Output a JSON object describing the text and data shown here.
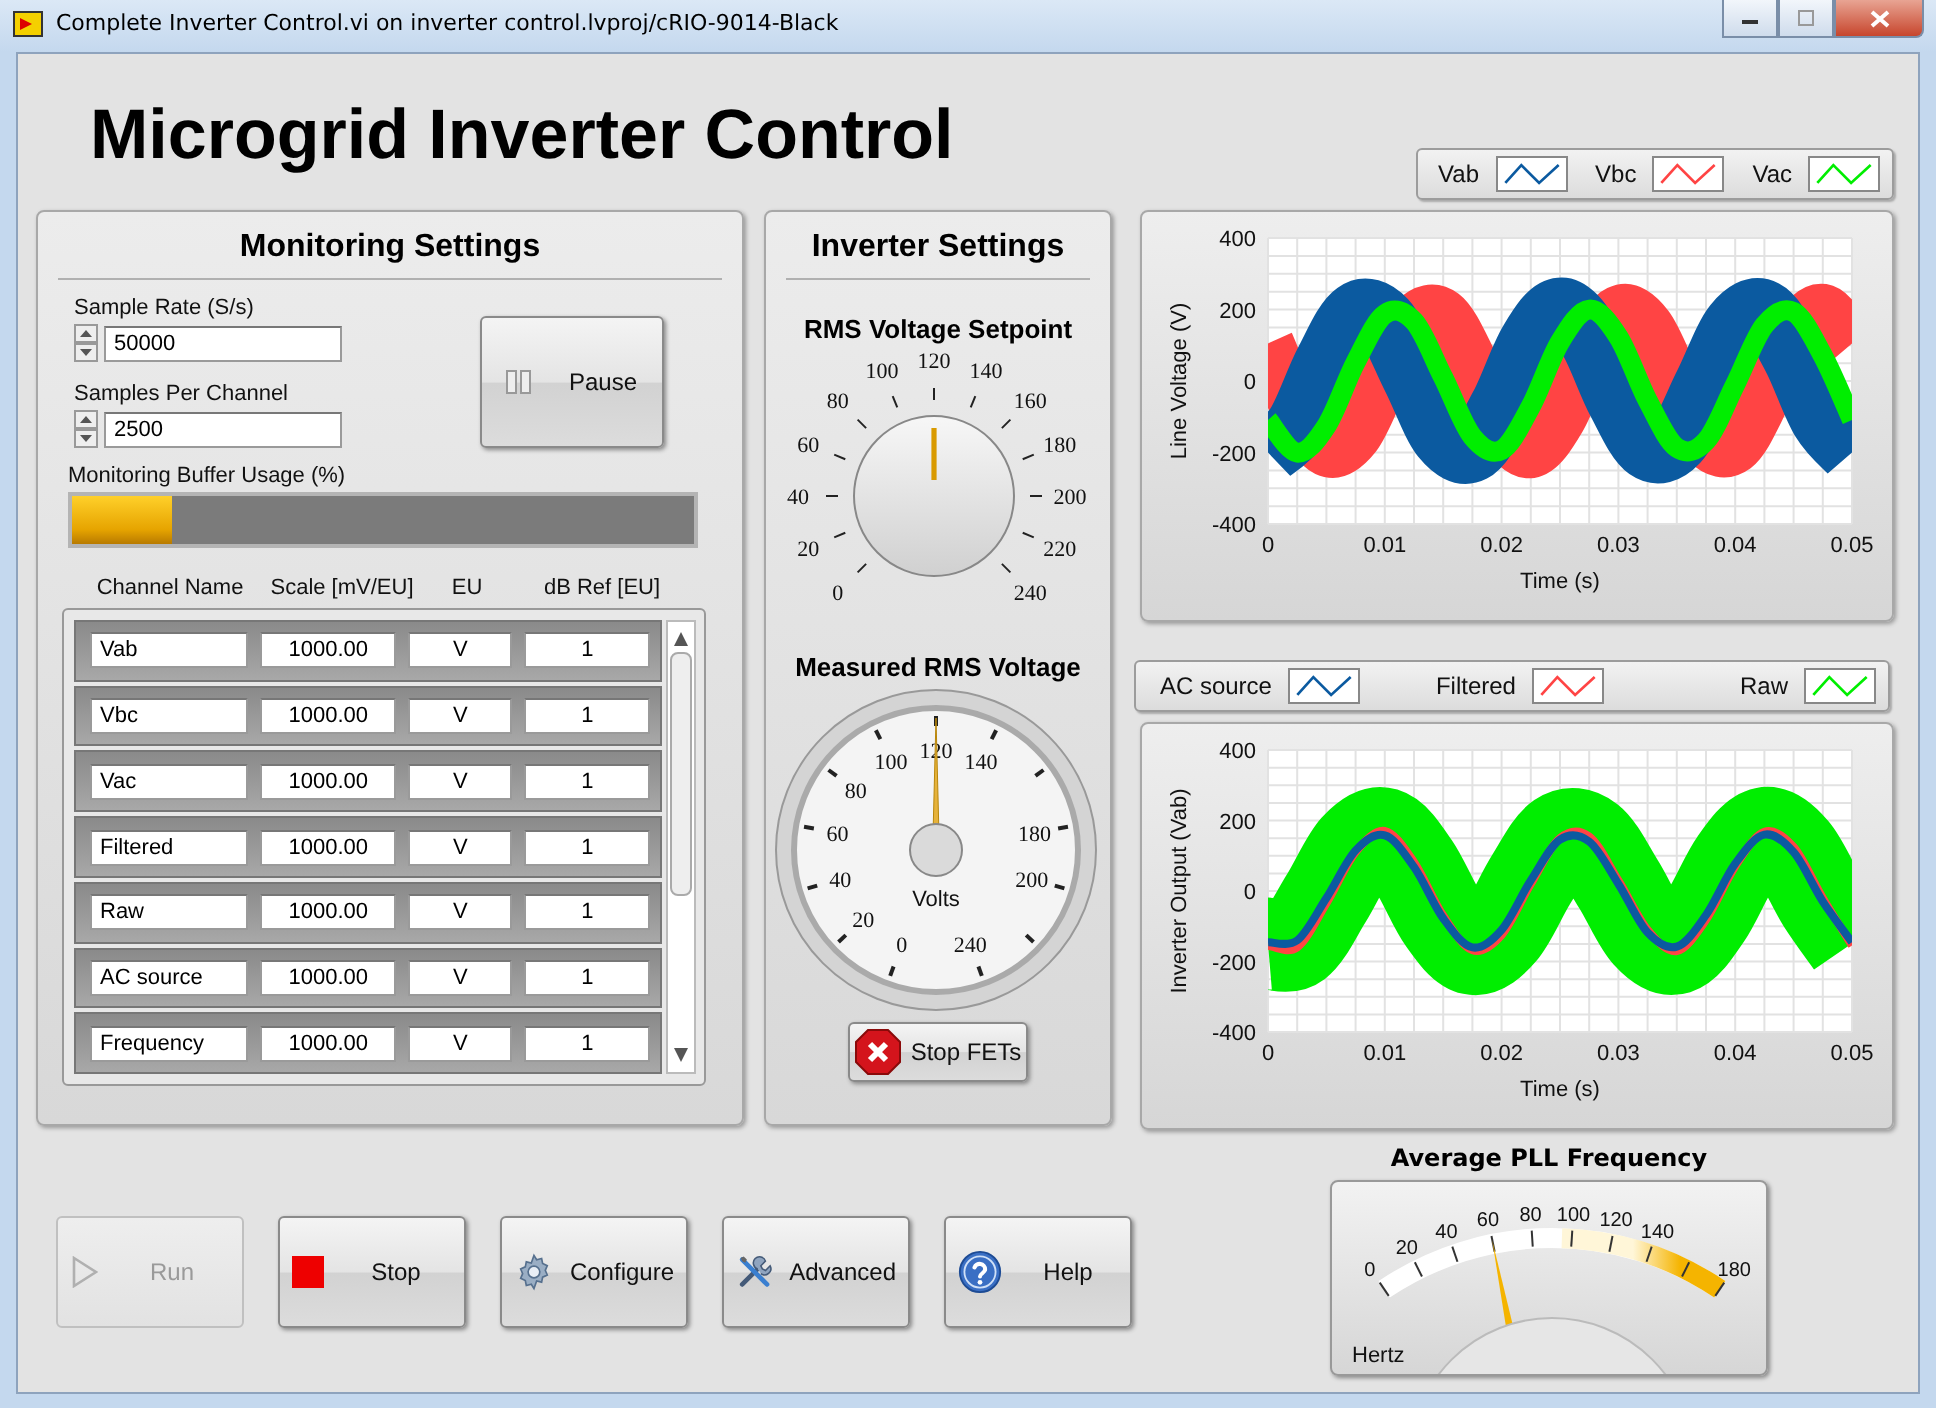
{
  "window": {
    "title": "Complete Inverter Control.vi on inverter control.lvproj/cRIO-9014-Black"
  },
  "header": {
    "title": "Microgrid Inverter Control"
  },
  "monitoring": {
    "title": "Monitoring Settings",
    "sample_rate": {
      "label": "Sample Rate (S/s)",
      "value": "50000"
    },
    "samples_per_channel": {
      "label": "Samples Per Channel",
      "value": "2500"
    },
    "pause_button": "Pause",
    "buffer": {
      "label": "Monitoring Buffer Usage (%)",
      "level": 0.16
    },
    "table": {
      "columns": [
        "Channel Name",
        "Scale [mV/EU]",
        "EU",
        "dB Ref [EU]"
      ],
      "rows": [
        {
          "name": "Vab",
          "scale": "1000.00",
          "eu": "V",
          "db_ref": "1"
        },
        {
          "name": "Vbc",
          "scale": "1000.00",
          "eu": "V",
          "db_ref": "1"
        },
        {
          "name": "Vac",
          "scale": "1000.00",
          "eu": "V",
          "db_ref": "1"
        },
        {
          "name": "Filtered",
          "scale": "1000.00",
          "eu": "V",
          "db_ref": "1"
        },
        {
          "name": "Raw",
          "scale": "1000.00",
          "eu": "V",
          "db_ref": "1"
        },
        {
          "name": "AC source",
          "scale": "1000.00",
          "eu": "V",
          "db_ref": "1"
        },
        {
          "name": "Frequency",
          "scale": "1000.00",
          "eu": "V",
          "db_ref": "1"
        }
      ]
    }
  },
  "inverter": {
    "title": "Inverter Settings",
    "setpoint": {
      "label": "RMS Voltage Setpoint",
      "ticks": [
        "0",
        "20",
        "40",
        "60",
        "80",
        "100",
        "120",
        "140",
        "160",
        "180",
        "200",
        "220",
        "240"
      ],
      "level": 0.5
    },
    "measured": {
      "label": "Measured RMS Voltage",
      "ticks": [
        "0",
        "20",
        "40",
        "60",
        "80",
        "100",
        "120",
        "140",
        "180",
        "200",
        "240"
      ],
      "unit": "Volts",
      "level": 0.5
    },
    "stop_fets_button": "Stop FETs"
  },
  "line_chart": {
    "chart_data": {
      "type": "line",
      "xlabel": "Time (s)",
      "ylabel": "Line Voltage (V)",
      "x": [
        0,
        0.0025,
        0.005,
        0.0075,
        0.01,
        0.0125,
        0.015,
        0.0175,
        0.02,
        0.0225,
        0.025,
        0.0275,
        0.03,
        0.0325,
        0.035,
        0.0375,
        0.04,
        0.0425,
        0.045,
        0.0475,
        0.05
      ],
      "series": [
        {
          "name": "Vab",
          "color": "#0b5aa0",
          "values": [
            -200,
            -126,
            52,
            187,
            167,
            10,
            -156,
            -193,
            -71,
            109,
            200,
            123,
            -54,
            -187,
            -168,
            -10,
            156,
            193,
            71,
            -109,
            -200
          ]
        },
        {
          "name": "Vbc",
          "color": "#ff4444",
          "values": [
            105,
            -76,
            -194,
            -152,
            15,
            170,
            185,
            47,
            -130,
            -199,
            -105,
            76,
            194,
            153,
            -15,
            -170,
            -185,
            -47,
            129,
            199,
            105
          ]
        },
        {
          "name": "Vac",
          "color": "#00ee00",
          "values": [
            -109,
            -200,
            -126,
            52,
            187,
            167,
            10,
            -156,
            -193,
            -71,
            109,
            200,
            123,
            -54,
            -187,
            -168,
            -10,
            156,
            193,
            71,
            -109
          ]
        }
      ],
      "xlim": [
        0,
        0.05
      ],
      "ylim": [
        -400,
        400
      ],
      "xticks": [
        0,
        0.01,
        0.02,
        0.03,
        0.04,
        0.05
      ],
      "yticks": [
        -400,
        -200,
        0,
        200,
        400
      ],
      "grid": true
    }
  },
  "output_chart": {
    "chart_data": {
      "type": "line",
      "xlabel": "Time (s)",
      "ylabel": "Inverter Output (Vab)",
      "x": [
        0,
        0.0025,
        0.005,
        0.0075,
        0.01,
        0.0125,
        0.015,
        0.0175,
        0.02,
        0.0225,
        0.025,
        0.0275,
        0.03,
        0.0325,
        0.035,
        0.0375,
        0.04,
        0.0425,
        0.045,
        0.0475,
        0.05
      ],
      "series": [
        {
          "name": "AC source",
          "color": "#0b5aa0",
          "values": [
            -145,
            -140,
            -20,
            115,
            158,
            68,
            -78,
            -160,
            -110,
            30,
            146,
            140,
            20,
            -118,
            -158,
            -68,
            78,
            160,
            110,
            -30,
            -145
          ]
        },
        {
          "name": "Filtered",
          "color": "#ff4444",
          "values": [
            -155,
            -160,
            -35,
            110,
            170,
            82,
            -70,
            -168,
            -125,
            20,
            150,
            155,
            30,
            -110,
            -170,
            -82,
            70,
            168,
            125,
            -20,
            -155
          ]
        },
        {
          "name": "Raw",
          "color": "#00ee00",
          "values": [
            -149,
            -145,
            -20,
            120,
            162,
            70,
            -80,
            -164,
            -113,
            31,
            150,
            143,
            20,
            -121,
            -162,
            -70,
            80,
            164,
            113,
            -31,
            -149
          ]
        }
      ],
      "xlim": [
        0,
        0.05
      ],
      "ylim": [
        -400,
        400
      ],
      "xticks": [
        0,
        0.01,
        0.02,
        0.03,
        0.04,
        0.05
      ],
      "yticks": [
        -400,
        -200,
        0,
        200,
        400
      ],
      "grid": true
    }
  },
  "buttons": [
    {
      "label": "Run",
      "kind": "run",
      "disabled": true
    },
    {
      "label": "Stop",
      "kind": "stop",
      "disabled": false
    },
    {
      "label": "Configure",
      "kind": "configure",
      "disabled": false
    },
    {
      "label": "Advanced",
      "kind": "advanced",
      "disabled": false
    },
    {
      "label": "Help",
      "kind": "help",
      "disabled": false
    }
  ],
  "pll": {
    "title": "Average PLL Frequency",
    "ticks": [
      "0",
      "20",
      "40",
      "60",
      "80",
      "100",
      "120",
      "140",
      "180"
    ],
    "unit": "Hertz",
    "level": 0.333
  }
}
